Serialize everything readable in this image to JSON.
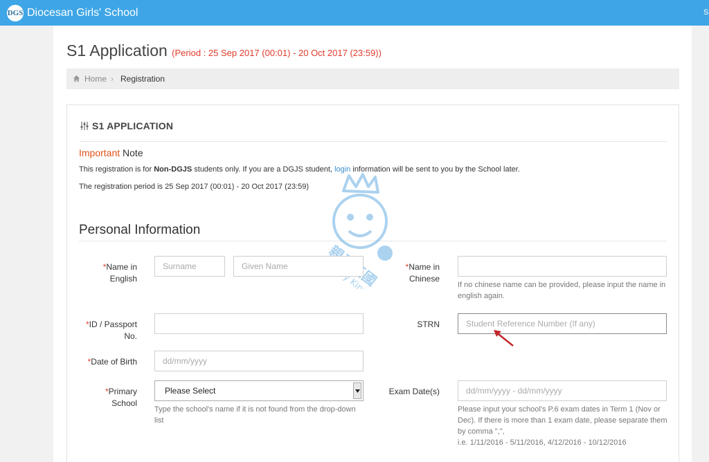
{
  "header": {
    "logo_text": "DGS",
    "brand": "Diocesan Girls' School",
    "edge_text": "S"
  },
  "page": {
    "title": "S1 Application",
    "period": "(Period : 25 Sep 2017 (00:01) - 20 Oct 2017 (23:59))"
  },
  "breadcrumb": {
    "home": "Home",
    "separator": "›",
    "current": "Registration"
  },
  "panel": {
    "heading": "S1 APPLICATION"
  },
  "note": {
    "title_highlight": "Important",
    "title_rest": "Note",
    "line1_pre": "This registration is for ",
    "line1_bold": "Non-DGJS",
    "line1_mid": " students only. If you are a DGJS student, ",
    "line1_link": "login",
    "line1_post": " information will be sent to you by the School later.",
    "line2": "The registration period is 25 Sep 2017 (00:01) - 20 Oct 2017 (23:59)"
  },
  "section": {
    "title": "Personal Information"
  },
  "form": {
    "required_mark": "*",
    "name_en_label": "Name in English",
    "surname_placeholder": "Surname",
    "given_name_placeholder": "Given Name",
    "name_zh_label": "Name in Chinese",
    "name_zh_help": "If no chinese name can be provided, please input the name in english again.",
    "id_label": "ID / Passport No.",
    "strn_label": "STRN",
    "strn_placeholder": "Student Reference Number (If any)",
    "dob_label": "Date of Birth",
    "dob_placeholder": "dd/mm/yyyy",
    "school_label": "Primary School",
    "school_value": "Please Select",
    "school_help": "Type the school's name if it is not found from the drop-down list",
    "exam_label": "Exam Date(s)",
    "exam_placeholder": "dd/mm/yyyy - dd/mm/yyyy",
    "exam_help_1": "Please input your school's P.6 exam dates in Term 1 (Nov or Dec). If there is more than 1 exam date, please separate them by comma \",\",",
    "exam_help_2": "i.e. 1/11/2016 - 5/11/2016, 4/12/2016 - 10/12/2016"
  },
  "watermark": {
    "cjk": "親子王國",
    "latin": "Baby Kingdom"
  },
  "colors": {
    "header": "#3ea6e6",
    "required": "#e03a2b",
    "period": "#e03a2b",
    "link": "#3a8fd6",
    "arrow": "#c0282d"
  }
}
